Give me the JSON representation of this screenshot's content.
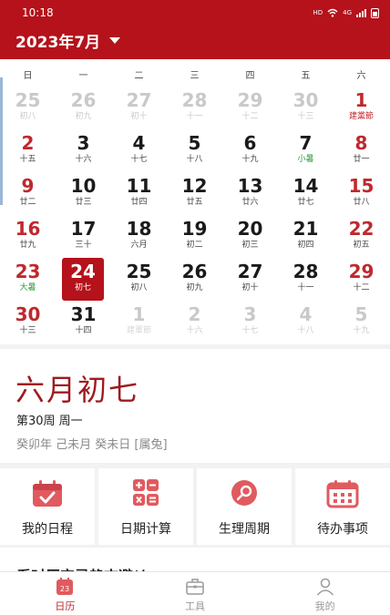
{
  "status_bar": {
    "time": "10:18",
    "hd": "HD",
    "network": "4G"
  },
  "header": {
    "month_title": "2023年7月"
  },
  "calendar": {
    "weekdays": [
      "日",
      "一",
      "二",
      "三",
      "四",
      "五",
      "六"
    ],
    "weeks": [
      [
        {
          "day": "25",
          "lunar": "初八",
          "other": true
        },
        {
          "day": "26",
          "lunar": "初九",
          "other": true
        },
        {
          "day": "27",
          "lunar": "初十",
          "other": true
        },
        {
          "day": "28",
          "lunar": "十一",
          "other": true
        },
        {
          "day": "29",
          "lunar": "十二",
          "other": true
        },
        {
          "day": "30",
          "lunar": "十三",
          "other": true
        },
        {
          "day": "1",
          "lunar": "建黨節",
          "festival": true
        }
      ],
      [
        {
          "day": "2",
          "lunar": "十五"
        },
        {
          "day": "3",
          "lunar": "十六"
        },
        {
          "day": "4",
          "lunar": "十七"
        },
        {
          "day": "5",
          "lunar": "十八"
        },
        {
          "day": "6",
          "lunar": "十九"
        },
        {
          "day": "7",
          "lunar": "小暑",
          "term": true
        },
        {
          "day": "8",
          "lunar": "廿一"
        }
      ],
      [
        {
          "day": "9",
          "lunar": "廿二"
        },
        {
          "day": "10",
          "lunar": "廿三"
        },
        {
          "day": "11",
          "lunar": "廿四"
        },
        {
          "day": "12",
          "lunar": "廿五"
        },
        {
          "day": "13",
          "lunar": "廿六"
        },
        {
          "day": "14",
          "lunar": "廿七"
        },
        {
          "day": "15",
          "lunar": "廿八"
        }
      ],
      [
        {
          "day": "16",
          "lunar": "廿九"
        },
        {
          "day": "17",
          "lunar": "三十"
        },
        {
          "day": "18",
          "lunar": "六月"
        },
        {
          "day": "19",
          "lunar": "初二"
        },
        {
          "day": "20",
          "lunar": "初三"
        },
        {
          "day": "21",
          "lunar": "初四"
        },
        {
          "day": "22",
          "lunar": "初五"
        }
      ],
      [
        {
          "day": "23",
          "lunar": "大暑",
          "term": true
        },
        {
          "day": "24",
          "lunar": "初七",
          "selected": true
        },
        {
          "day": "25",
          "lunar": "初八"
        },
        {
          "day": "26",
          "lunar": "初九"
        },
        {
          "day": "27",
          "lunar": "初十"
        },
        {
          "day": "28",
          "lunar": "十一"
        },
        {
          "day": "29",
          "lunar": "十二"
        }
      ],
      [
        {
          "day": "30",
          "lunar": "十三"
        },
        {
          "day": "31",
          "lunar": "十四"
        },
        {
          "day": "1",
          "lunar": "建軍節",
          "other": true,
          "festival": true
        },
        {
          "day": "2",
          "lunar": "十六",
          "other": true
        },
        {
          "day": "3",
          "lunar": "十七",
          "other": true
        },
        {
          "day": "4",
          "lunar": "十八",
          "other": true
        },
        {
          "day": "5",
          "lunar": "十九",
          "other": true
        }
      ]
    ]
  },
  "selected_info": {
    "lunar_date": "六月初七",
    "week_line": "第30周   周一",
    "ganzhi": "癸卯年 己未月 癸未日 [属兔]"
  },
  "tools": [
    {
      "label": "我的日程",
      "icon": "calendar-check-icon"
    },
    {
      "label": "日期计算",
      "icon": "calculator-icon"
    },
    {
      "label": "生理周期",
      "icon": "period-cycle-icon"
    },
    {
      "label": "待办事项",
      "icon": "todo-calendar-icon"
    }
  ],
  "teaser": {
    "text": "看时辰宜忌趋吉避凶"
  },
  "tabbar": [
    {
      "label": "日历",
      "icon": "calendar-icon",
      "active": true
    },
    {
      "label": "工具",
      "icon": "toolbox-icon",
      "active": false
    },
    {
      "label": "我的",
      "icon": "user-icon",
      "active": false
    }
  ],
  "colors": {
    "brand": "#b5121b",
    "weekend": "#c0282d",
    "term": "#2e9e3e",
    "tool_icon": "#e05a5f"
  }
}
